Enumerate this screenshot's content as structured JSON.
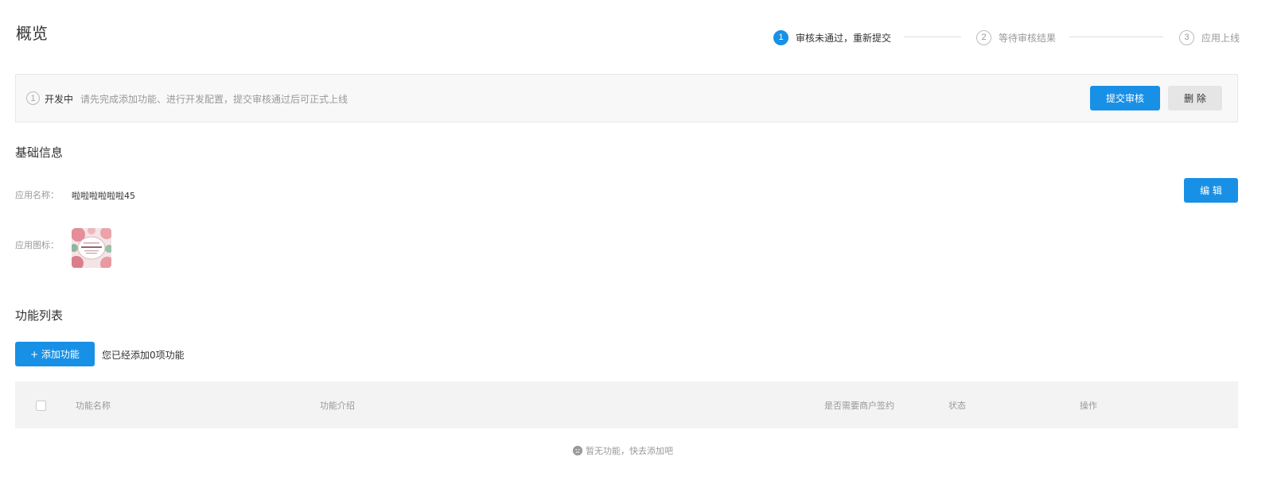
{
  "header": {
    "title": "概览"
  },
  "steps": [
    {
      "number": "1",
      "label": "审核未通过，重新提交",
      "state": "active"
    },
    {
      "number": "2",
      "label": "等待审核结果",
      "state": "pending"
    },
    {
      "number": "3",
      "label": "应用上线",
      "state": "pending"
    }
  ],
  "status": {
    "icon_text": "1",
    "label": "开发中",
    "description": "请先完成添加功能、进行开发配置，提交审核通过后可正式上线",
    "submit_label": "提交审核",
    "delete_label": "删 除"
  },
  "basic_info": {
    "title": "基础信息",
    "name_label": "应用名称：",
    "name_value": "啦啦啦啦啦啦45",
    "icon_label": "应用图标：",
    "edit_label": "编 辑"
  },
  "functions": {
    "title": "功能列表",
    "add_label": "+ 添加功能",
    "count_text": "您已经添加0项功能",
    "columns": [
      "功能名称",
      "功能介绍",
      "是否需要商户签约",
      "状态",
      "操作"
    ],
    "empty_text": "暂无功能，快去添加吧"
  },
  "colors": {
    "primary": "#1890e6",
    "secondary_button": "#e5e5e5",
    "table_header_bg": "#f3f3f3",
    "banner_bg": "#f8f8f8"
  }
}
